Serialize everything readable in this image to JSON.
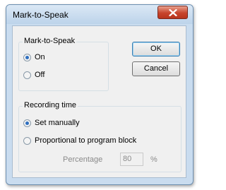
{
  "window": {
    "title": "Mark-to-Speak"
  },
  "mark_group": {
    "label": "Mark-to-Speak",
    "options": [
      {
        "label": "On",
        "checked": true
      },
      {
        "label": "Off",
        "checked": false
      }
    ]
  },
  "buttons": {
    "ok": "OK",
    "cancel": "Cancel"
  },
  "recording_group": {
    "label": "Recording time",
    "options": [
      {
        "label": "Set manually",
        "checked": true
      },
      {
        "label": "Proportional to program block",
        "checked": false
      }
    ],
    "percentage_label": "Percentage",
    "percentage_value": "80",
    "percentage_unit": "%"
  }
}
